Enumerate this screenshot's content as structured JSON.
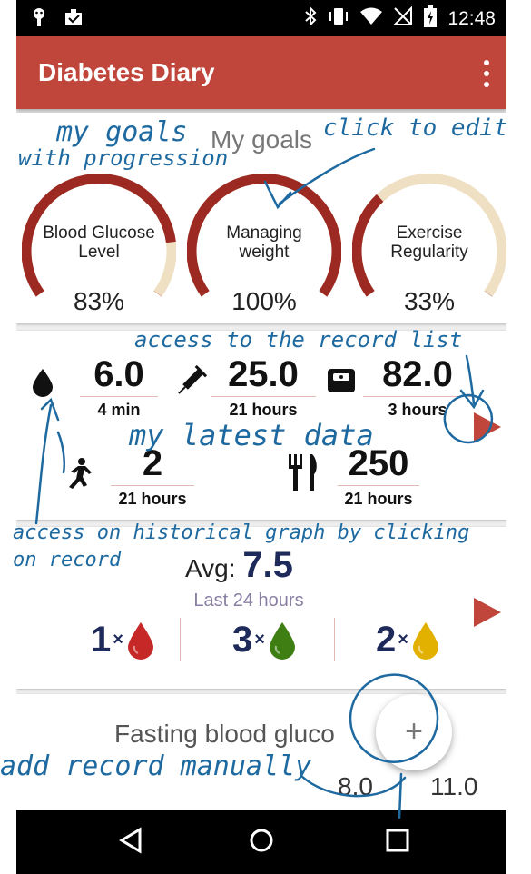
{
  "status_bar": {
    "time": "12:48"
  },
  "app": {
    "title": "Diabetes Diary"
  },
  "goals": {
    "title": "My goals",
    "items": [
      {
        "label_line1": "Blood Glucose",
        "label_line2": "Level",
        "percent": "83%",
        "progress": 0.83
      },
      {
        "label_line1": "Managing",
        "label_line2": "weight",
        "percent": "100%",
        "progress": 1.0
      },
      {
        "label_line1": "Exercise",
        "label_line2": "Regularity",
        "percent": "33%",
        "progress": 0.33
      }
    ]
  },
  "latest": {
    "glucose": {
      "value": "6.0",
      "time": "4 min"
    },
    "insulin": {
      "value": "25.0",
      "time": "21 hours"
    },
    "weight": {
      "value": "82.0",
      "time": "3 hours"
    },
    "exercise": {
      "value": "2",
      "time": "21 hours"
    },
    "food": {
      "value": "250",
      "time": "21 hours"
    }
  },
  "average": {
    "label": "Avg:",
    "value": "7.5",
    "period": "Last 24 hours",
    "counts": [
      {
        "count": "1",
        "times": "×",
        "color": "#c62828"
      },
      {
        "count": "3",
        "times": "×",
        "color": "#3f7e12"
      },
      {
        "count": "2",
        "times": "×",
        "color": "#e2b100"
      }
    ]
  },
  "fasting": {
    "title": "Fasting blood gluco",
    "low": "8.0",
    "high": "11.0"
  },
  "fab": {
    "label": "+"
  },
  "annotations": {
    "my_goals": "my goals",
    "with_progression": "with progression",
    "click_to_edit": "click to edit",
    "record_list": "access to the record list",
    "latest_data": "my latest data",
    "historical_line1": "access on historical graph by clicking",
    "historical_line2": "on record",
    "add_record": "add record manually"
  },
  "colors": {
    "primary": "#c0463b",
    "gauge_fill": "#9c2a22",
    "gauge_track": "#efe0c4",
    "annotation": "#1e6aa0"
  }
}
